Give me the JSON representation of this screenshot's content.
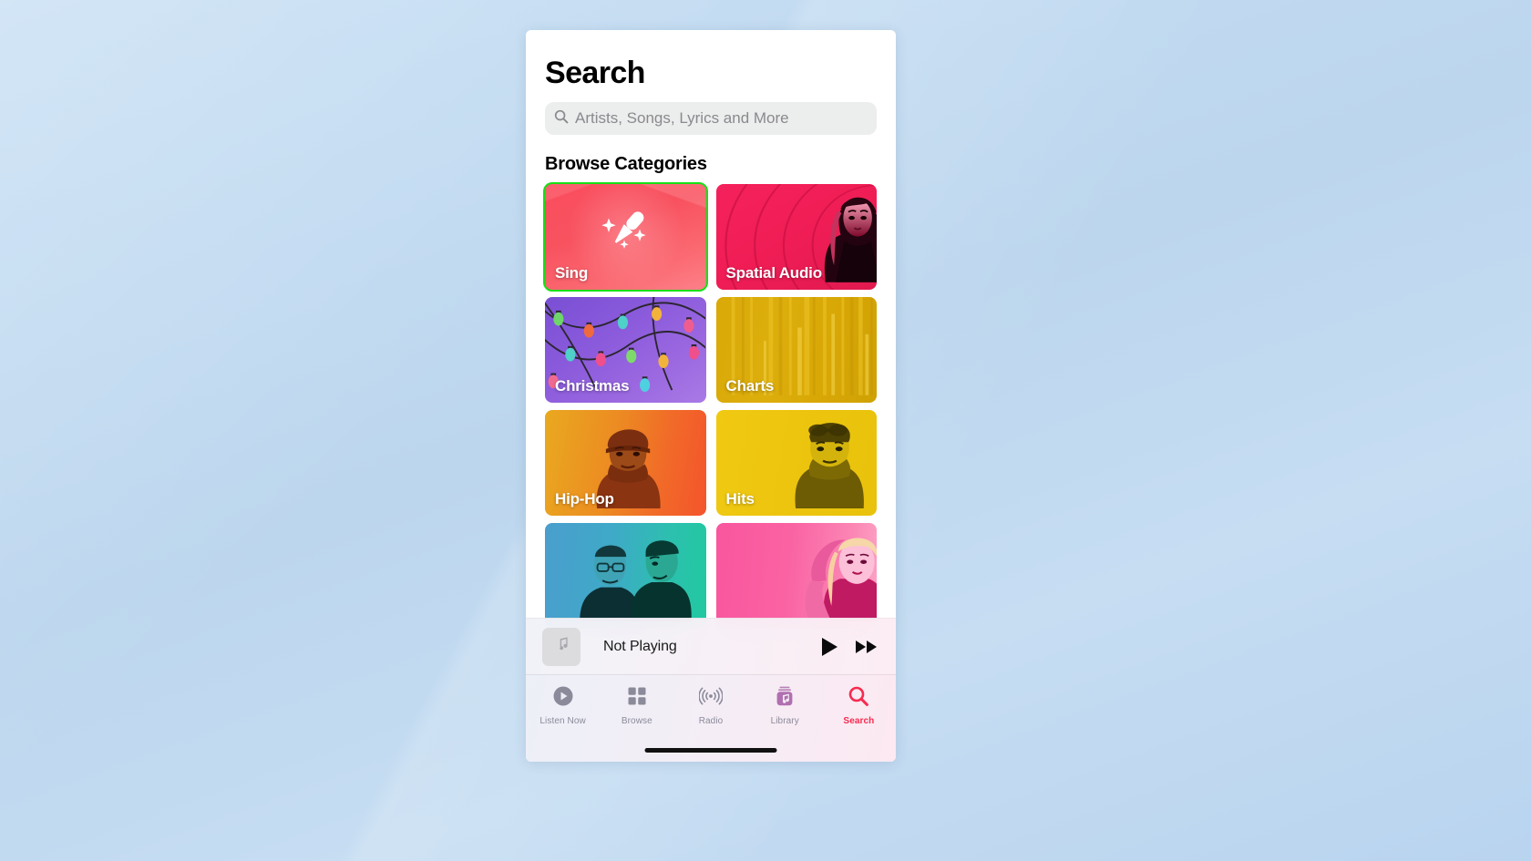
{
  "app": {
    "page_title": "Search"
  },
  "search": {
    "placeholder": "Artists, Songs, Lyrics and More",
    "value": "",
    "icon": "search-icon"
  },
  "browse": {
    "section_title": "Browse Categories",
    "tiles": [
      {
        "label": "Sing",
        "art": "microphone-sparkles",
        "selected": true,
        "accent": "#f8525f"
      },
      {
        "label": "Spatial Audio",
        "art": "portrait-rings",
        "selected": false,
        "accent": "#f01d55"
      },
      {
        "label": "Christmas",
        "art": "string-lights",
        "selected": false,
        "accent": "#8b5bdc"
      },
      {
        "label": "Charts",
        "art": "gold-bars",
        "selected": false,
        "accent": "#d9a908"
      },
      {
        "label": "Hip-Hop",
        "art": "portrait-orange",
        "selected": false,
        "accent": "#f16a28"
      },
      {
        "label": "Hits",
        "art": "portrait-yellow",
        "selected": false,
        "accent": "#edc50f"
      },
      {
        "label": "",
        "art": "portrait-teal-duo",
        "selected": false,
        "accent": "#2cc0ae"
      },
      {
        "label": "",
        "art": "portrait-pink",
        "selected": false,
        "accent": "#fa63a3"
      }
    ]
  },
  "now_playing": {
    "title": "Not Playing",
    "artwork_icon": "music-note-icon",
    "play_label": "play-icon",
    "next_label": "fast-forward-icon"
  },
  "tabbar": {
    "items": [
      {
        "label": "Listen Now",
        "icon": "play-circle-icon",
        "active": false
      },
      {
        "label": "Browse",
        "icon": "grid-icon",
        "active": false
      },
      {
        "label": "Radio",
        "icon": "broadcast-icon",
        "active": false
      },
      {
        "label": "Library",
        "icon": "library-icon",
        "active": false
      },
      {
        "label": "Search",
        "icon": "search-icon",
        "active": true
      }
    ],
    "active_color": "#f72b4f",
    "inactive_color": "#8b8a9a"
  }
}
